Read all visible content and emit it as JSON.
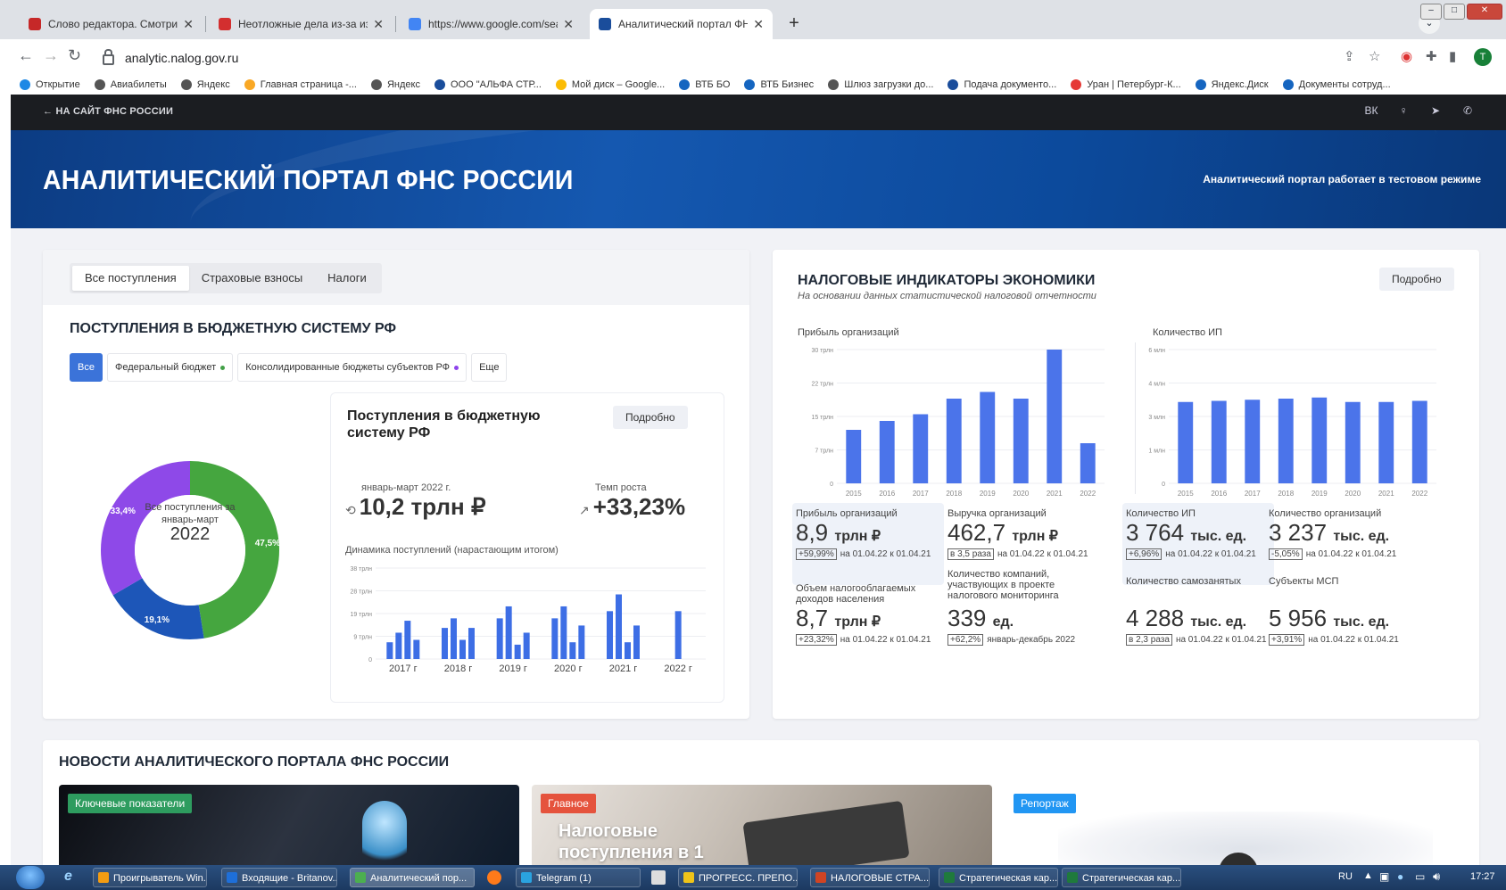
{
  "browser": {
    "tabs": [
      {
        "title": "Слово редактора. Смотри, как",
        "favicon_color": "#c62828"
      },
      {
        "title": "Неотложные дела из-за изменени",
        "favicon_color": "#d32f2f"
      },
      {
        "title": "https://www.google.com/search?",
        "favicon_color": "#4285f4"
      },
      {
        "title": "Аналитический портал ФНС Рос",
        "favicon_color": "#1a4d9b"
      }
    ],
    "active_tab_index": 3,
    "close_glyph": "✕",
    "new_tab_glyph": "+",
    "url": "analytic.nalog.gov.ru",
    "profile_initial": "T",
    "bookmarks": [
      "Открытие",
      "Авиабилеты",
      "Яндекс",
      "Главная страница -...",
      "Яндекс",
      "ООО \"АЛЬФА СТР...",
      "Мой диск – Google...",
      "ВТБ БО",
      "ВТБ Бизнес",
      "Шлюз загрузки до...",
      "Подача документо...",
      "Уран | Петербург-К...",
      "Яндекс.Диск",
      "Документы сотруд..."
    ]
  },
  "site": {
    "back_link": "← НА САЙТ ФНС РОССИИ",
    "social_icons": [
      "vk-icon",
      "ok-icon",
      "telegram-icon",
      "phone-icon"
    ],
    "hero_title": "АНАЛИТИЧЕСКИЙ ПОРТАЛ ФНС РОССИИ",
    "hero_note": "Аналитический портал работает в тестовом режиме"
  },
  "left": {
    "tabs": [
      "Все поступления",
      "Страховые взносы",
      "Налоги"
    ],
    "section_title": "ПОСТУПЛЕНИЯ В БЮДЖЕТНУЮ СИСТЕМУ РФ",
    "filters": [
      {
        "label": "Все",
        "active": true,
        "dot": null
      },
      {
        "label": "Федеральный бюджет",
        "active": false,
        "dot": "#43a047"
      },
      {
        "label": "Консолидированные бюджеты субъектов РФ",
        "active": false,
        "dot": "#8e44ec"
      },
      {
        "label": "Еще",
        "active": false,
        "dot": null
      }
    ],
    "donut": {
      "segments": [
        {
          "label": "47,5%",
          "value": 47.5,
          "color": "#45a63f"
        },
        {
          "label": "19,1%",
          "value": 19.1,
          "color": "#1d56b8"
        },
        {
          "label": "33,4%",
          "value": 33.4,
          "color": "#8e49e8"
        }
      ],
      "center_text": "Все поступления за январь-март",
      "center_year": "2022"
    },
    "inner": {
      "title": "Поступления в бюджетную систему РФ",
      "details_button": "Подробно",
      "period_label": "январь-март 2022 г.",
      "total": "10,2 трлн ₽",
      "growth_label": "Темп роста",
      "growth": "+33,23%",
      "chart_title": "Динамика поступлений (нарастающим итогом)"
    }
  },
  "right": {
    "title": "НАЛОГОВЫЕ ИНДИКАТОРЫ ЭКОНОМИКИ",
    "subtitle": "На основании данных статистической налоговой отчетности",
    "details_button": "Подробно",
    "chart1_title": "Прибыль организаций",
    "chart2_title": "Количество ИП",
    "indicators": [
      {
        "label": "Прибыль организаций",
        "value": "8,9",
        "unit": "трлн ₽",
        "badge": "+59,99%",
        "note": "на 01.04.22 к 01.04.21",
        "highlight": true
      },
      {
        "label": "Выручка организаций",
        "value": "462,7",
        "unit": "трлн ₽",
        "badge": "в 3,5 раза",
        "note": "на 01.04.22 к 01.04.21",
        "highlight": false
      },
      {
        "label": "Количество ИП",
        "value": "3 764",
        "unit": "тыс. ед.",
        "badge": "+6,96%",
        "note": "на 01.04.22 к 01.04.21",
        "highlight": true
      },
      {
        "label": "Количество организаций",
        "value": "3 237",
        "unit": "тыс. ед.",
        "badge": "-5,05%",
        "note": "на 01.04.22 к 01.04.21",
        "highlight": false
      },
      {
        "label": "Объем налогооблагаемых доходов населения",
        "value": "8,7",
        "unit": "трлн ₽",
        "badge": "+23,32%",
        "note": "на 01.04.22 к 01.04.21",
        "highlight": false
      },
      {
        "label": "Количество компаний, участвующих в проекте налогового мониторинга",
        "value": "339",
        "unit": "ед.",
        "badge": "+62,2%",
        "note": "январь-декабрь 2022",
        "highlight": false
      },
      {
        "label": "Количество самозанятых",
        "value": "4 288",
        "unit": "тыс. ед.",
        "badge": "в 2,3 раза",
        "note": "на 01.04.22 к 01.04.21",
        "highlight": false
      },
      {
        "label": "Субъекты МСП",
        "value": "5 956",
        "unit": "тыс. ед.",
        "badge": "+3,91%",
        "note": "на 01.04.22 к 01.04.21",
        "highlight": false
      }
    ]
  },
  "news": {
    "title": "НОВОСТИ АНАЛИТИЧЕСКОГО ПОРТАЛА ФНС РОССИИ",
    "items": [
      {
        "tag": "Ключевые показатели",
        "tag_color": "#2e9c5f",
        "caption": ""
      },
      {
        "tag": "Главное",
        "tag_color": "#e5533d",
        "caption": "Налоговые поступления в 1"
      },
      {
        "tag": "Репортаж",
        "tag_color": "#2196f3",
        "caption": ""
      }
    ]
  },
  "taskbar": {
    "items": [
      {
        "label": "Проигрыватель Win...",
        "color": "#f39c12"
      },
      {
        "label": "Входящие - Britanov...",
        "color": "#1e6fd9"
      },
      {
        "label": "Аналитический пор...",
        "color": "#4caf50"
      },
      {
        "label": "Telegram (1)",
        "color": "#2aa3e0"
      },
      {
        "label": "ПРОГРЕСС. ПРЕПО...",
        "color": "#f0c419"
      },
      {
        "label": "НАЛОГОВЫЕ СТРА...",
        "color": "#d04423"
      },
      {
        "label": "Стратегическая кар...",
        "color": "#1f7a3c"
      },
      {
        "label": "Стратегическая кар...",
        "color": "#1f7a3c"
      }
    ],
    "lang": "RU",
    "clock": "17:27"
  },
  "chart_data": [
    {
      "type": "bar",
      "title": "Динамика поступлений (нарастающим итогом)",
      "categories": [
        "2017 г",
        "2018 г",
        "2019 г",
        "2020 г",
        "2021 г",
        "2022 г"
      ],
      "series": [
        {
          "name": "",
          "values": [
            7,
            11,
            16,
            8,
            13,
            17,
            8,
            13,
            17,
            22,
            6,
            11,
            17,
            22,
            7,
            14,
            20,
            27,
            7,
            14,
            20,
            27,
            35,
            10
          ]
        }
      ],
      "ytick_labels": [
        "0",
        "9 трлн",
        "19 трлн",
        "28 трлн",
        "38 трлн"
      ],
      "ylim": [
        0,
        38
      ]
    },
    {
      "type": "bar",
      "title": "Прибыль организаций",
      "categories": [
        "2015",
        "2016",
        "2017",
        "2018",
        "2019",
        "2020",
        "2021",
        "2022"
      ],
      "values": [
        12,
        14,
        15.5,
        19,
        20.5,
        19,
        30,
        9
      ],
      "ytick_labels": [
        "0",
        "7 трлн",
        "15 трлн",
        "22 трлн",
        "30 трлн"
      ],
      "ylim": [
        0,
        30
      ]
    },
    {
      "type": "bar",
      "title": "Количество ИП",
      "categories": [
        "2015",
        "2016",
        "2017",
        "2018",
        "2019",
        "2020",
        "2021",
        "2022"
      ],
      "values": [
        3.65,
        3.7,
        3.75,
        3.8,
        3.85,
        3.65,
        3.65,
        3.7
      ],
      "ytick_labels": [
        "0",
        "1 млн",
        "3 млн",
        "4 млн",
        "6 млн"
      ],
      "ylim": [
        0,
        6
      ]
    }
  ]
}
